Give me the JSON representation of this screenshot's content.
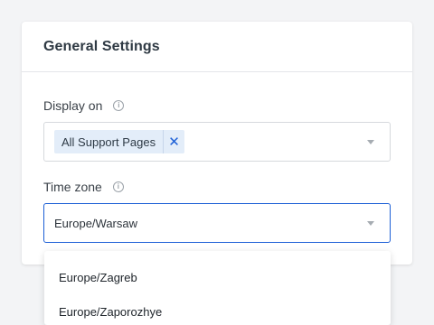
{
  "card": {
    "title": "General Settings"
  },
  "display_on": {
    "label": "Display on",
    "info_icon": "info-icon",
    "chip_label": "All Support Pages",
    "chip_remove_icon": "close-icon",
    "chip_remove_glyph": "✕"
  },
  "time_zone": {
    "label": "Time zone",
    "info_icon": "info-icon",
    "value": "Europe/Warsaw",
    "options": [
      "Europe/Zagreb",
      "Europe/Zaporozhye"
    ]
  },
  "colors": {
    "accent": "#1c5fd6",
    "chip_bg": "#e3edf9"
  }
}
